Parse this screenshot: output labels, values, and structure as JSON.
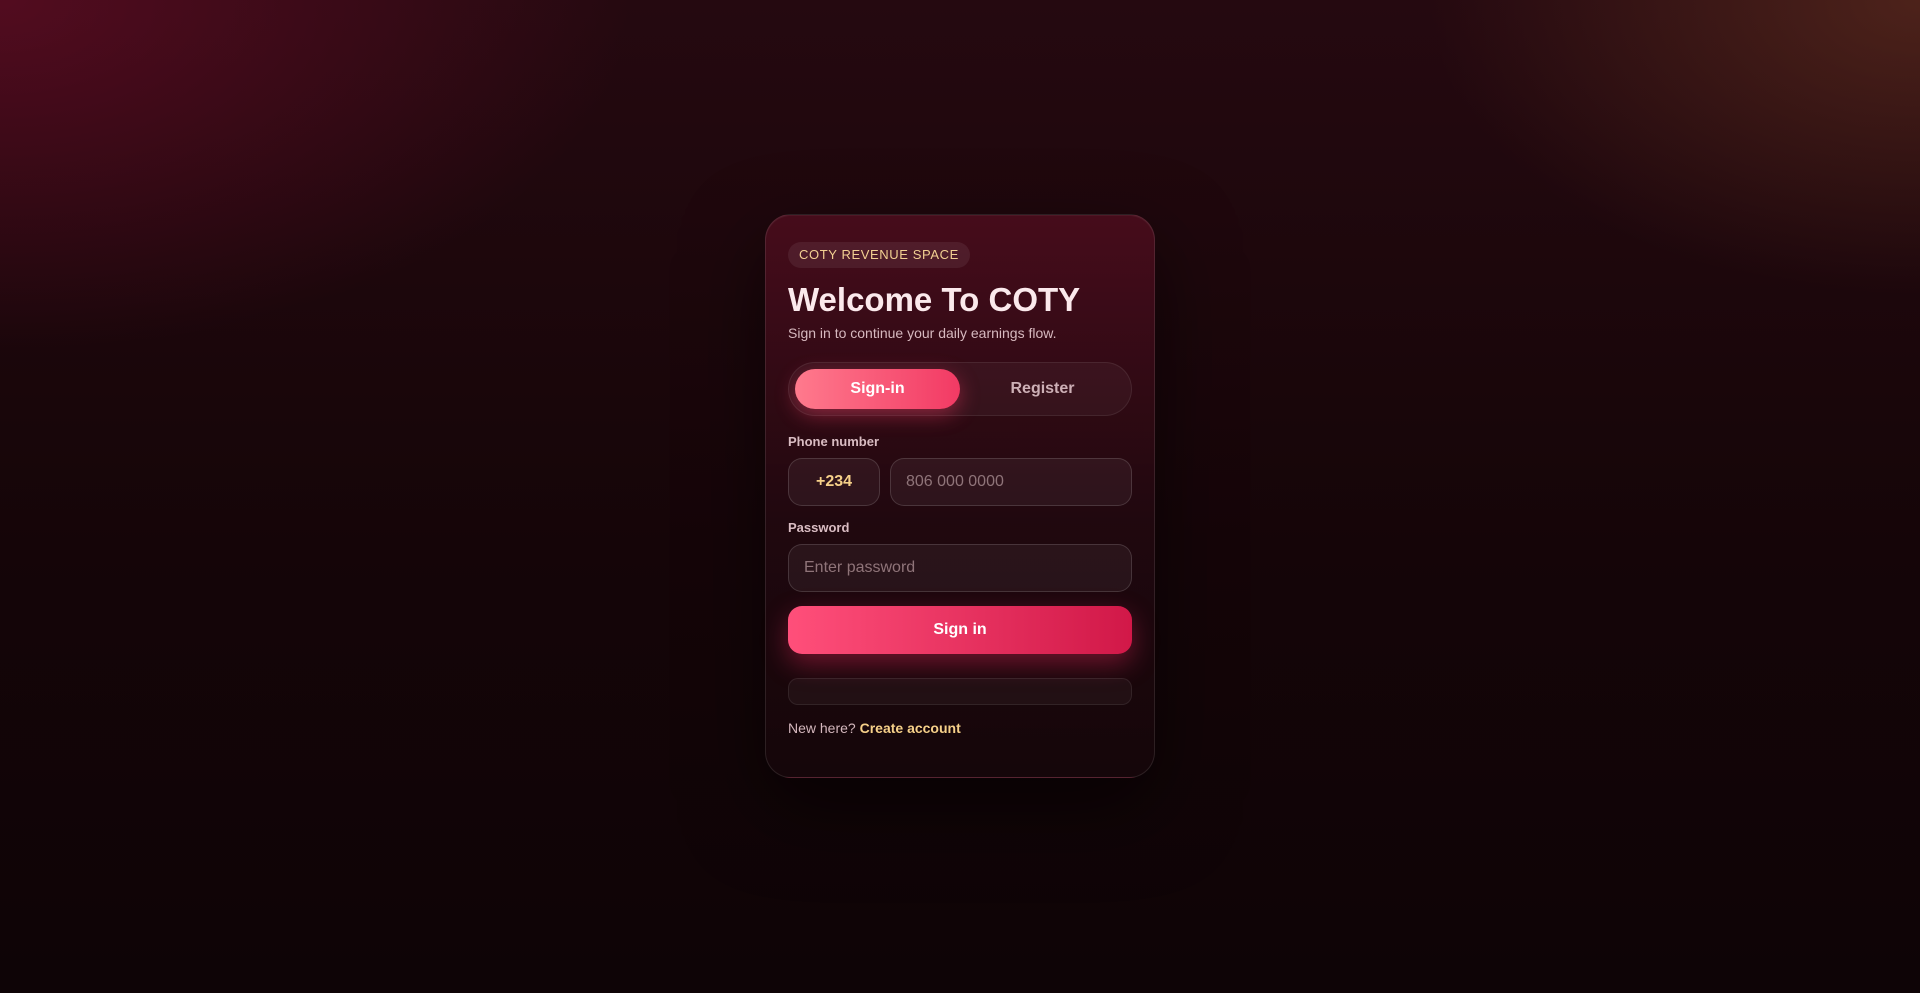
{
  "card": {
    "badge": "COTY REVENUE SPACE",
    "title": "Welcome To COTY",
    "subtitle": "Sign in to continue your daily earnings flow."
  },
  "tabs": [
    {
      "label": "Sign-in",
      "active": true
    },
    {
      "label": "Register",
      "active": false
    }
  ],
  "phone": {
    "label": "Phone number",
    "country_code": "+234",
    "placeholder": "806 000 0000",
    "value": ""
  },
  "password": {
    "label": "Password",
    "placeholder": "Enter password",
    "value": ""
  },
  "submit_label": "Sign in",
  "footer": {
    "prompt": "New here?",
    "link": "Create account"
  },
  "colors": {
    "accent": "#f23a64",
    "gold": "#f6d089",
    "background": "#150508"
  }
}
